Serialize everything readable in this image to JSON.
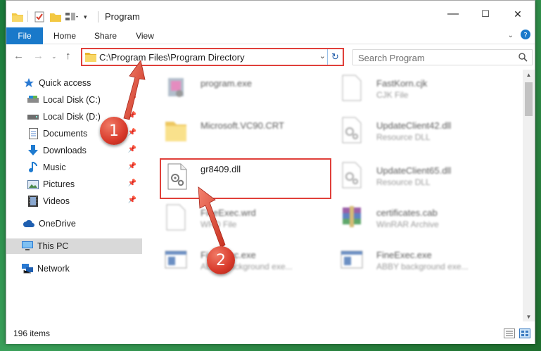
{
  "window": {
    "title": "Program",
    "minimize_glyph": "—",
    "maximize_glyph": "☐",
    "close_glyph": "✕"
  },
  "ribbon": {
    "tabs": [
      "File",
      "Home",
      "Share",
      "View"
    ]
  },
  "address": {
    "path": "C:\\Program Files\\Program Directory"
  },
  "search": {
    "placeholder": "Search Program"
  },
  "nav": {
    "items": [
      {
        "label": "Quick access",
        "icon": "star-icon"
      },
      {
        "label": "Local Disk (C:)",
        "icon": "drive-icon",
        "pinned": true
      },
      {
        "label": "Local Disk (D:)",
        "icon": "drive-icon",
        "pinned": true
      },
      {
        "label": "Documents",
        "icon": "documents-icon",
        "pinned": true
      },
      {
        "label": "Downloads",
        "icon": "download-icon",
        "pinned": true
      },
      {
        "label": "Music",
        "icon": "music-icon",
        "pinned": true
      },
      {
        "label": "Pictures",
        "icon": "pictures-icon",
        "pinned": true
      },
      {
        "label": "Videos",
        "icon": "videos-icon",
        "pinned": true
      },
      {
        "label": "OneDrive",
        "icon": "cloud-icon"
      },
      {
        "label": "This PC",
        "icon": "computer-icon",
        "selected": true
      },
      {
        "label": "Network",
        "icon": "network-icon"
      }
    ]
  },
  "files": [
    {
      "name": "program.exe",
      "type": "",
      "icon": "exe-icon"
    },
    {
      "name": "FastKorn.cjk",
      "type": "CJK File",
      "icon": "blank-file-icon"
    },
    {
      "name": "Microsoft.VC90.CRT",
      "type": "",
      "icon": "folder-icon"
    },
    {
      "name": "UpdateClient42.dll",
      "type": "Resource DLL",
      "icon": "dll-icon"
    },
    {
      "name": "gr8409.dll",
      "type": "",
      "icon": "dll-icon"
    },
    {
      "name": "UpdateClient65.dll",
      "type": "Resource DLL",
      "icon": "dll-icon"
    },
    {
      "name": "FineExec.wrd",
      "type": "WRD File",
      "icon": "blank-file-icon"
    },
    {
      "name": "certificates.cab",
      "type": "WinRAR Archive",
      "icon": "archive-icon"
    },
    {
      "name": "FineExec.exe",
      "type": "ABBY background exe...",
      "icon": "app-window-icon"
    },
    {
      "name": "FineExec.exe",
      "type": "ABBY background exe...",
      "icon": "app-window-icon"
    }
  ],
  "status": {
    "item_count": "196 items"
  },
  "callouts": [
    "1",
    "2"
  ],
  "colors": {
    "accent": "#1979ca",
    "highlight": "#e0403a"
  }
}
